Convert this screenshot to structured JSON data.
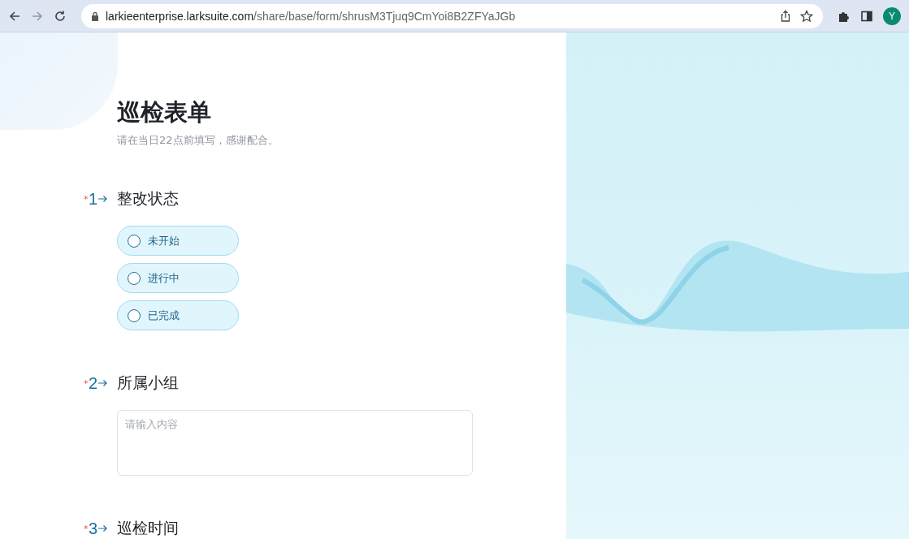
{
  "browser": {
    "url_domain": "larkieenterprise.larksuite.com",
    "url_path": "/share/base/form/shrusM3Tjuq9CmYoi8B2ZFYaJGb",
    "avatar": "Y"
  },
  "form": {
    "title": "巡检表单",
    "description": "请在当日22点前填写，感谢配合。",
    "questions": [
      {
        "kind": "choice",
        "mark": "*",
        "number": "1",
        "label": "整改状态",
        "options": [
          {
            "label": "未开始",
            "selected": false
          },
          {
            "label": "进行中",
            "selected": false
          },
          {
            "label": "已完成",
            "selected": false
          }
        ]
      },
      {
        "kind": "text",
        "mark": "*",
        "number": "2",
        "label": "所属小组",
        "placeholder": "请输入内容"
      },
      {
        "kind": "heading",
        "mark": "*",
        "number": "3",
        "label": "巡检时间"
      }
    ]
  }
}
